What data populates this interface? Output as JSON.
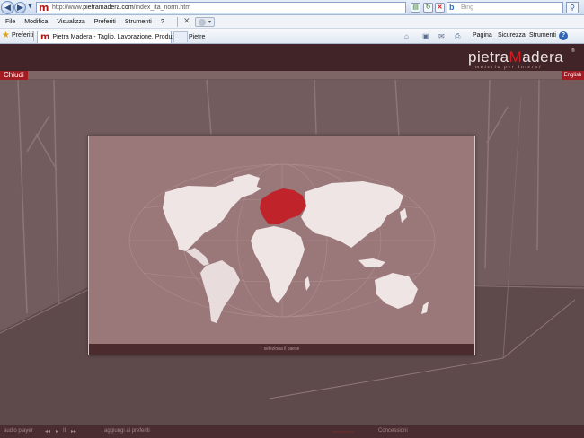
{
  "browser": {
    "url_prefix": "http://www.",
    "url_domain": "pietramadera.com",
    "url_path": "/index_ita_norm.htm",
    "search_placeholder": "Bing",
    "menu": [
      "File",
      "Modifica",
      "Visualizza",
      "Preferiti",
      "Strumenti",
      "?"
    ],
    "favorites_label": "Preferiti",
    "tab_title": "Pietra Madera - Taglio, Lavorazione, Produzione Pietre",
    "commands": [
      "Pagina",
      "Sicurezza",
      "Strumenti"
    ],
    "help_label": "?"
  },
  "site": {
    "logo_part1": "pietra",
    "logo_m": "M",
    "logo_part2": "adera",
    "logo_reg": "®",
    "tagline": "materia per interni",
    "close_label": "Chiudi",
    "language_label": "English",
    "map_caption": "seleziona il paese",
    "footer": {
      "audio_label": "audio player",
      "audio_controls": [
        "◂◂",
        "▸",
        "II",
        "▸▸"
      ],
      "add_fav": "aggiungi ai preferiti",
      "concessions": "Concessioni"
    },
    "colors": {
      "accent": "#a31c22",
      "header": "#412427",
      "selected_region": "#c0242a",
      "land": "#efe5e5"
    }
  }
}
